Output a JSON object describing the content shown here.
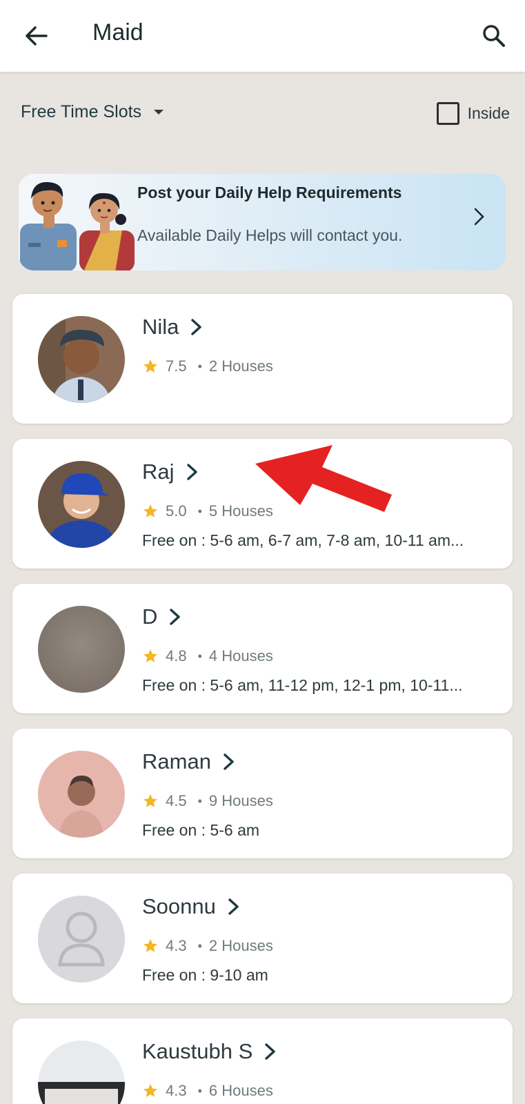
{
  "header": {
    "title": "Maid"
  },
  "filters": {
    "slots_label": "Free Time Slots",
    "inside_label": "Inside"
  },
  "banner": {
    "title": "Post your Daily Help Requirements",
    "subtitle": "Available Daily Helps will contact you."
  },
  "colors": {
    "star": "#f5b623",
    "arrow": "#e52222",
    "accent_dark": "#1f3a42"
  },
  "helpers": [
    {
      "name": "Nila",
      "rating": "7.5",
      "houses": "2 Houses",
      "free": ""
    },
    {
      "name": "Raj",
      "rating": "5.0",
      "houses": "5 Houses",
      "free": "Free on : 5-6 am, 6-7 am, 7-8 am, 10-11 am..."
    },
    {
      "name": "D",
      "rating": "4.8",
      "houses": "4 Houses",
      "free": "Free on : 5-6 am, 11-12 pm, 12-1 pm, 10-11..."
    },
    {
      "name": "Raman",
      "rating": "4.5",
      "houses": "9 Houses",
      "free": "Free on : 5-6 am"
    },
    {
      "name": "Soonnu",
      "rating": "4.3",
      "houses": "2 Houses",
      "free": "Free on : 9-10 am"
    },
    {
      "name": "Kaustubh S",
      "rating": "4.3",
      "houses": "6 Houses",
      "free": ""
    }
  ]
}
